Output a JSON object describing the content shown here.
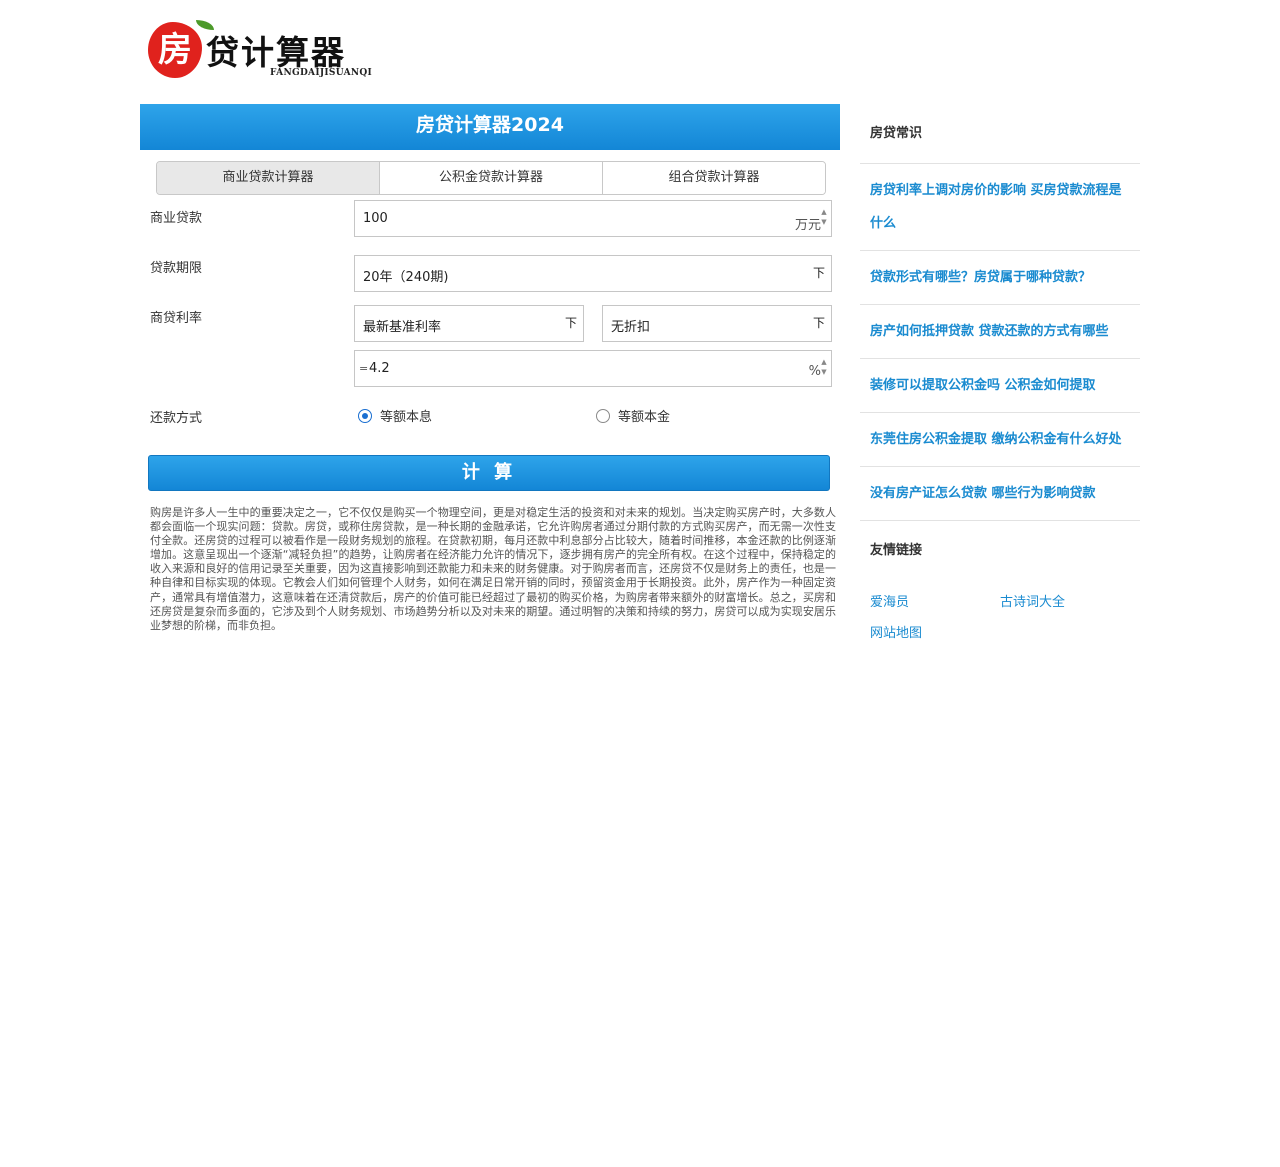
{
  "logo": {
    "badge_char": "房",
    "text": "贷计算器",
    "pinyin": "FANGDAIJISUANQI"
  },
  "calculator": {
    "title": "房贷计算器2024",
    "tabs": [
      {
        "label": "商业贷款计算器",
        "active": true
      },
      {
        "label": "公积金贷款计算器",
        "active": false
      },
      {
        "label": "组合贷款计算器",
        "active": false
      }
    ],
    "loan_amount": {
      "label": "商业贷款",
      "value": "100",
      "unit": "万元"
    },
    "loan_term": {
      "label": "贷款期限",
      "value": "20年（240期)",
      "dropdown_glyph": "下"
    },
    "rate": {
      "label": "商贷利率",
      "base_select": "最新基准利率",
      "discount_select": "无折扣",
      "dropdown_glyph": "下",
      "prefix": "=",
      "value": "4.2",
      "unit": "%"
    },
    "repayment": {
      "label": "还款方式",
      "options": [
        {
          "label": "等额本息",
          "checked": true
        },
        {
          "label": "等额本金",
          "checked": false
        }
      ]
    },
    "calculate_button": "计 算",
    "description": "购房是许多人一生中的重要决定之一，它不仅仅是购买一个物理空间，更是对稳定生活的投资和对未来的规划。当决定购买房产时，大多数人都会面临一个现实问题：贷款。房贷，或称住房贷款，是一种长期的金融承诺，它允许购房者通过分期付款的方式购买房产，而无需一次性支付全款。还房贷的过程可以被看作是一段财务规划的旅程。在贷款初期，每月还款中利息部分占比较大，随着时间推移，本金还款的比例逐渐增加。这意呈现出一个逐渐“减轻负担”的趋势，让购房者在经济能力允许的情况下，逐步拥有房产的完全所有权。在这个过程中，保持稳定的收入来源和良好的信用记录至关重要，因为这直接影响到还款能力和未来的财务健康。对于购房者而言，还房贷不仅是财务上的责任，也是一种自律和目标实现的体现。它教会人们如何管理个人财务，如何在满足日常开销的同时，预留资金用于长期投资。此外，房产作为一种固定资产，通常具有增值潜力，这意味着在还清贷款后，房产的价值可能已经超过了最初的购买价格，为购房者带来额外的财富增长。总之，买房和还房贷是复杂而多面的，它涉及到个人财务规划、市场趋势分析以及对未来的期望。通过明智的决策和持续的努力，房贷可以成为实现安居乐业梦想的阶梯，而非负担。"
  },
  "sidebar": {
    "knowledge_title": "房贷常识",
    "articles": [
      {
        "title": "房贷利率上调对房价的影响 买房贷款流程是什么",
        "lines": 2
      },
      {
        "title": "贷款形式有哪些？房贷属于哪种贷款？",
        "lines": 1
      },
      {
        "title": "房产如何抵押贷款 贷款还款的方式有哪些",
        "lines": 1
      },
      {
        "title": "装修可以提取公积金吗 公积金如何提取",
        "lines": 1
      },
      {
        "title": "东莞住房公积金提取 缴纳公积金有什么好处",
        "lines": 2
      },
      {
        "title": "没有房产证怎么贷款 哪些行为影响贷款",
        "lines": 1
      }
    ],
    "friends_title": "友情链接",
    "friend_links": [
      "爱海员",
      "古诗词大全",
      "网站地图"
    ]
  },
  "colors": {
    "brand_blue": "#1a8bd0",
    "header_gradient_top": "#2ea4ea",
    "header_gradient_bottom": "#1386d6",
    "logo_red": "#e0221d"
  }
}
